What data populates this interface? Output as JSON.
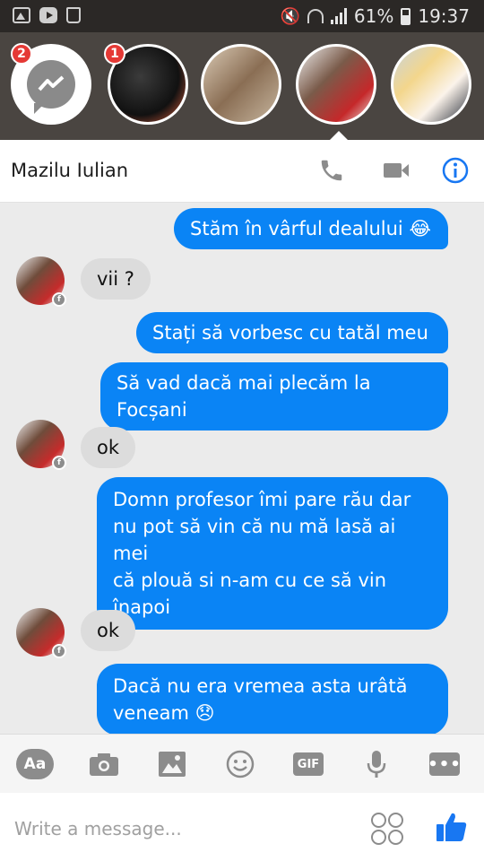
{
  "status_bar": {
    "battery": "61%",
    "time": "19:37",
    "left_icons": [
      "gallery-icon",
      "youtube-icon",
      "recycle-icon"
    ],
    "right_icons": [
      "mute-icon",
      "wifi-icon",
      "signal-icon",
      "battery-icon"
    ]
  },
  "chat_heads": {
    "items": [
      {
        "kind": "messenger",
        "badge": "2"
      },
      {
        "kind": "contact",
        "badge": "1"
      },
      {
        "kind": "contact",
        "badge": ""
      },
      {
        "kind": "contact",
        "badge": "",
        "active": true
      },
      {
        "kind": "contact",
        "badge": ""
      }
    ]
  },
  "conversation": {
    "title": "Mazilu Iulian",
    "actions": [
      "phone-icon",
      "video-camera-icon",
      "info-icon"
    ]
  },
  "messages": [
    {
      "from": "me",
      "text": "Stăm în vârful dealului 😂"
    },
    {
      "from": "them",
      "text": "vii ?"
    },
    {
      "from": "me",
      "text": "Stați să vorbesc cu tatăl meu"
    },
    {
      "from": "me",
      "text": "Să vad dacă mai plecăm la Focșani"
    },
    {
      "from": "them",
      "text": "ok"
    },
    {
      "from": "me",
      "lines": [
        "Domn profesor îmi pare rău dar",
        "nu pot să vin că nu mă lasă ai mei",
        "că plouă si n-am cu ce să vin",
        "înapoi"
      ]
    },
    {
      "from": "them",
      "text": "ok"
    },
    {
      "from": "me",
      "lines": [
        "Dacă nu era vremea asta urâtă",
        "veneam 😞"
      ]
    }
  ],
  "toolbar": {
    "aa_label": "Aa",
    "gif_label": "GIF",
    "more_label": "•••",
    "items": [
      "text-format-button",
      "camera-icon",
      "image-icon",
      "emoji-icon",
      "gif-icon",
      "microphone-icon",
      "more-icon"
    ]
  },
  "composer": {
    "placeholder": "Write a message...",
    "value": ""
  },
  "colors": {
    "outgoing_bubble": "#0a84f5",
    "incoming_bubble": "#dcdcdc",
    "chat_background": "#ebebeb",
    "badge": "#e53935",
    "accent_info": "#1877f2",
    "like": "#1877f2"
  }
}
